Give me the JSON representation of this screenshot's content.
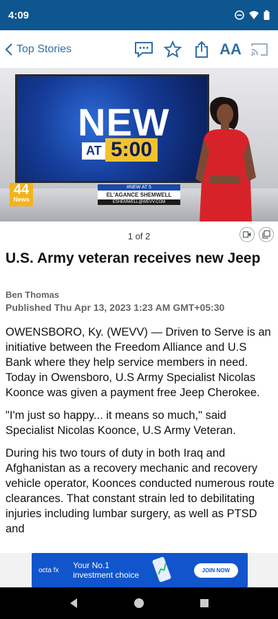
{
  "status": {
    "time": "4:09"
  },
  "toolbar": {
    "back_label": "Top Stories",
    "font_size_label": "AA"
  },
  "hero": {
    "screen_new": "NEW",
    "screen_at": "AT",
    "screen_time": "5:00",
    "logo_number": "44",
    "logo_word": "News",
    "lower_third_top": "#NEW AT 5",
    "lower_third_name": "EL'AGANCE SHEMWELL",
    "lower_third_email": "ESHEMWELL@WEVV.COM"
  },
  "pager": {
    "label": "1 of 2"
  },
  "article": {
    "headline": "U.S. Army veteran receives new Jeep",
    "author": "Ben Thomas",
    "published": "Published Thu Apr 13, 2023 1:23 AM GMT+05:30",
    "paragraphs": [
      "OWENSBORO, Ky. (WEVV) — Driven to Serve is an initiative between the Freedom Alliance and U.S Bank where they help service members in need. Today in Owensboro, U.S Army Specialist Nicolas Koonce was given a payment free Jeep Cherokee.",
      "\"I'm just so happy... it means so much,\" said Specialist Nicolas Koonce, U.S Army Veteran.",
      "During his two tours of duty in both Iraq and Afghanistan as a recovery mechanic and recovery vehicle operator, Koonces conducted numerous route clearances. That constant strain led to debilitating injuries including lumbar surgery, as well as PTSD and"
    ]
  },
  "ad": {
    "logo": "octa fx",
    "line1": "Your No.1",
    "line2": "investment choice",
    "button": "JOIN NOW"
  },
  "colors": {
    "status_bar": "#0d5690",
    "accent": "#2f6fa8"
  }
}
